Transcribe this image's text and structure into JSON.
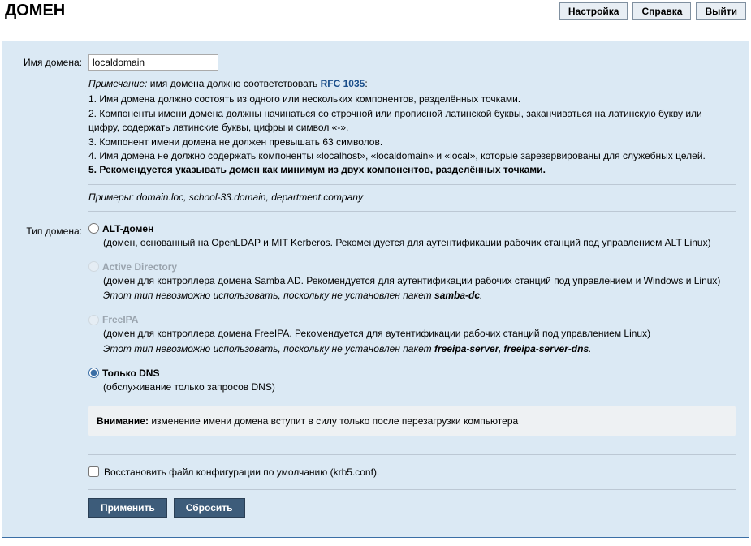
{
  "header": {
    "title": "ДОМЕН",
    "buttons": {
      "settings": "Настройка",
      "help": "Справка",
      "logout": "Выйти"
    }
  },
  "form": {
    "domain_name_label": "Имя домена:",
    "domain_name_value": "localdomain",
    "note_prefix": "Примечание:",
    "note_text": " имя домена должно соответствовать ",
    "note_link": "RFC 1035",
    "note_suffix": ":",
    "rules": {
      "r1": "1. Имя домена должно состоять из одного или нескольких компонентов, разделённых точками.",
      "r2": "2. Компоненты имени домена должны начинаться со строчной или прописной латинской буквы, заканчиваться на латинскую букву или цифру, содержать латинские буквы, цифры и символ «-».",
      "r3": "3. Компонент имени домена не должен превышать 63 символов.",
      "r4": "4. Имя домена не должно содержать компоненты «localhost», «localdomain» и «local», которые зарезервированы для служебных целей.",
      "r5": "5. Рекомендуется указывать домен как минимум из двух компонентов, разделённых точками."
    },
    "examples_prefix": "Примеры: ",
    "examples_text": "domain.loc, school-33.domain, department.company",
    "type_label": "Тип домена:",
    "options": {
      "alt": {
        "label": "ALT-домен",
        "desc": "(домен, основанный на OpenLDAP и MIT Kerberos. Рекомендуется для аутентификации рабочих станций под управлением ALT Linux)"
      },
      "ad": {
        "label": "Active Directory",
        "desc": "(домен для контроллера домена Samba AD. Рекомендуется для аутентификации рабочих станций под управлением и Windows и Linux)",
        "warn_prefix": "Этот тип невозможно использовать, поскольку не установлен пакет ",
        "warn_pkg": "samba-dc",
        "warn_suffix": "."
      },
      "ipa": {
        "label": "FreeIPA",
        "desc": "(домен для контроллера домена FreeIPA. Рекомендуется для аутентификации рабочих станций под управлением Linux)",
        "warn_prefix": "Этот тип невозможно использовать, поскольку не установлен пакет ",
        "warn_pkg": "freeipa-server, freeipa-server-dns",
        "warn_suffix": "."
      },
      "dns": {
        "label": "Только DNS",
        "desc": "(обслуживание только запросов DNS)"
      }
    },
    "attention_label": "Внимание:",
    "attention_text": " изменение имени домена вступит в силу только после перезагрузки компьютера",
    "restore_label": "Восстановить файл конфигурации по умолчанию (krb5.conf).",
    "apply_btn": "Применить",
    "reset_btn": "Сбросить"
  }
}
